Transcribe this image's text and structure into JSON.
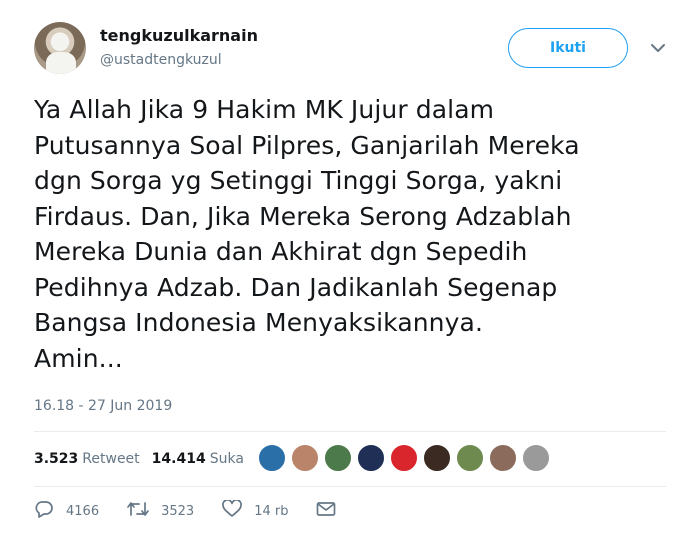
{
  "user": {
    "display_name": "tengkuzulkarnain",
    "handle": "@ustadtengkuzul",
    "avatar_icon": "profile-photo"
  },
  "header": {
    "follow_label": "Ikuti",
    "menu_icon": "chevron-down-icon"
  },
  "tweet": {
    "text": "Ya Allah Jika 9 Hakim MK Jujur dalam\nPutusannya Soal Pilpres, Ganjarilah Mereka\ndgn Sorga yg Setinggi Tinggi Sorga, yakni\nFirdaus. Dan, Jika Mereka Serong Adzablah\nMereka Dunia dan Akhirat dgn Sepedih\nPedihnya Adzab. Dan Jadikanlah Segenap\nBangsa Indonesia Menyaksikannya.\nAmin...",
    "timestamp": "16.18 - 27 Jun 2019"
  },
  "stats": {
    "retweet_count": "3.523",
    "retweet_label": "Retweet",
    "like_count": "14.414",
    "like_label": "Suka"
  },
  "likers": [
    {
      "color": "#2b6fa8"
    },
    {
      "color": "#b9846a"
    },
    {
      "color": "#4c7a4a"
    },
    {
      "color": "#1f2f55"
    },
    {
      "color": "#d9262c"
    },
    {
      "color": "#3b2a22"
    },
    {
      "color": "#6f8a4f"
    },
    {
      "color": "#8b6c5c"
    },
    {
      "color": "#9a9a9a"
    }
  ],
  "actions": {
    "reply_count": "4166",
    "retweet_count": "3523",
    "like_count": "14 rb"
  },
  "colors": {
    "accent": "#1da1f2",
    "text": "#14171a",
    "muted": "#657786",
    "divider": "#e6ecf0"
  }
}
